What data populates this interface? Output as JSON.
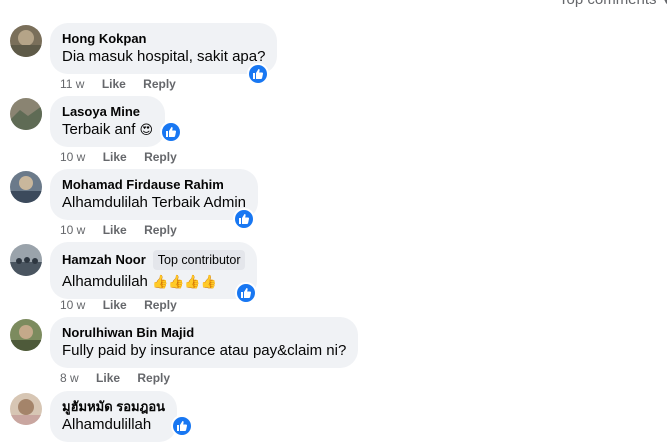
{
  "sort_label": "Top comments",
  "reaction_icon": "like-icon",
  "colors": {
    "like_blue": "#1877f2",
    "bubble_bg": "#f0f2f5",
    "meta_gray": "#65676b"
  },
  "actions": {
    "like": "Like",
    "reply": "Reply"
  },
  "comments": [
    {
      "author": "Hong Kokpan",
      "text": "Dia masuk hospital, sakit apa?",
      "time": "11 w"
    },
    {
      "author": "Lasoya Mine",
      "text": "Terbaik anf",
      "emoji": "😍",
      "time": "10 w"
    },
    {
      "author": "Mohamad Firdause Rahim",
      "text": "Alhamdulilah Terbaik Admin",
      "time": "10 w"
    },
    {
      "author": "Hamzah Noor",
      "badge": "Top contributor",
      "text": "Alhamdulilah",
      "emoji": "👍👍👍👍",
      "time": "10 w"
    },
    {
      "author": "Norulhiwan Bin Majid",
      "text": "Fully paid by insurance atau pay&claim ni?",
      "time": "8 w"
    },
    {
      "author": "มูฮัมหมัด รอมฎอน",
      "text": "Alhamdulillah"
    }
  ]
}
